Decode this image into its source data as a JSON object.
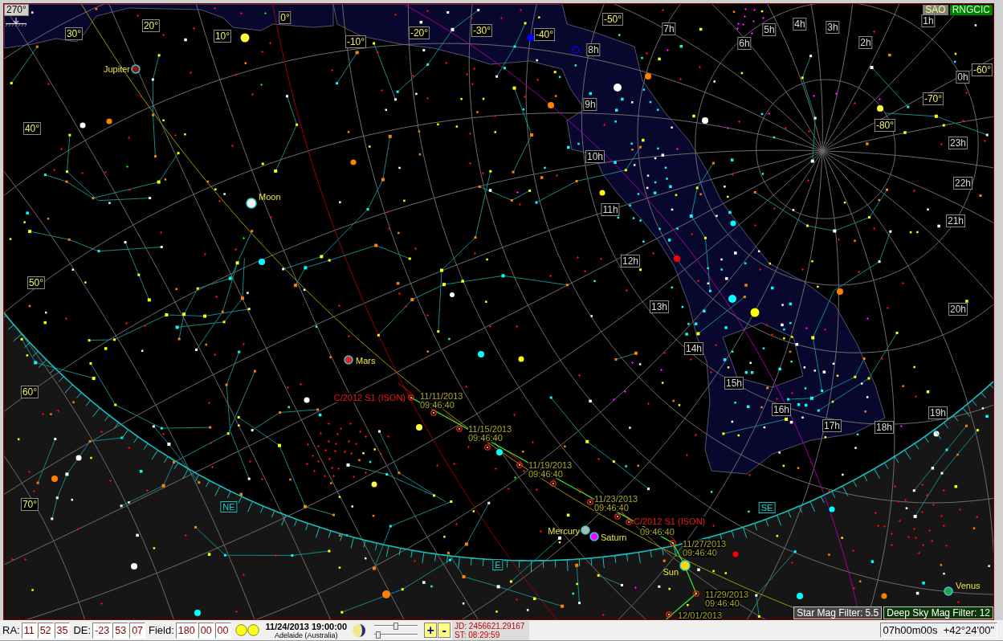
{
  "chart": {
    "corner_label": "270°",
    "catalogs": [
      {
        "label": "SAO",
        "on": false
      },
      {
        "label": "RNGCIC",
        "on": true
      }
    ],
    "grid_labels": [
      {
        "text": "30°",
        "kind": "declination"
      },
      {
        "text": "20°",
        "kind": "declination"
      },
      {
        "text": "10°",
        "kind": "declination"
      },
      {
        "text": "0°",
        "kind": "declination"
      },
      {
        "text": "-10°",
        "kind": "declination"
      },
      {
        "text": "-20°",
        "kind": "declination"
      },
      {
        "text": "-30°",
        "kind": "declination"
      },
      {
        "text": "-40°",
        "kind": "declination"
      },
      {
        "text": "-50°",
        "kind": "declination"
      },
      {
        "text": "7h",
        "kind": "hour"
      },
      {
        "text": "6h",
        "kind": "hour"
      },
      {
        "text": "5h",
        "kind": "hour"
      },
      {
        "text": "4h",
        "kind": "hour"
      },
      {
        "text": "3h",
        "kind": "hour"
      },
      {
        "text": "2h",
        "kind": "hour"
      },
      {
        "text": "1h",
        "kind": "hour"
      },
      {
        "text": "8h",
        "kind": "hour"
      },
      {
        "text": "0h",
        "kind": "hour"
      },
      {
        "text": "-60°",
        "kind": "declination"
      },
      {
        "text": "-70°",
        "kind": "declination"
      },
      {
        "text": "9h",
        "kind": "hour"
      },
      {
        "text": "-80°",
        "kind": "declination"
      },
      {
        "text": "40°",
        "kind": "declination"
      },
      {
        "text": "23h",
        "kind": "hour"
      },
      {
        "text": "10h",
        "kind": "hour"
      },
      {
        "text": "22h",
        "kind": "hour"
      },
      {
        "text": "11h",
        "kind": "hour"
      },
      {
        "text": "21h",
        "kind": "hour"
      },
      {
        "text": "12h",
        "kind": "hour"
      },
      {
        "text": "50°",
        "kind": "declination"
      },
      {
        "text": "13h",
        "kind": "hour"
      },
      {
        "text": "20h",
        "kind": "hour"
      },
      {
        "text": "14h",
        "kind": "hour"
      },
      {
        "text": "15h",
        "kind": "hour"
      },
      {
        "text": "60°",
        "kind": "declination"
      },
      {
        "text": "16h",
        "kind": "hour"
      },
      {
        "text": "19h",
        "kind": "hour"
      },
      {
        "text": "17h",
        "kind": "hour"
      },
      {
        "text": "18h",
        "kind": "hour"
      },
      {
        "text": "70°",
        "kind": "declination"
      }
    ],
    "horizon_labels": [
      "NE",
      "E",
      "SE"
    ],
    "bodies": [
      {
        "name": "Jupiter",
        "color": "#9a1010"
      },
      {
        "name": "Moon",
        "color": "#f0f0f0"
      },
      {
        "name": "Mars",
        "color": "#e82020"
      },
      {
        "name": "Mercury",
        "color": "#b4b4b4"
      },
      {
        "name": "Saturn",
        "color": "#ff00ff"
      },
      {
        "name": "Sun",
        "color": "#ffd800"
      },
      {
        "name": "Venus",
        "color": "#28a048"
      }
    ],
    "comet": {
      "name": "C/2012 S1 (ISON)",
      "current_label": "C/2012 S1 (ISON)",
      "path_labels": [
        {
          "date": "11/11/2013",
          "time": "09:46:40"
        },
        {
          "date": "11/15/2013",
          "time": "09:46:40"
        },
        {
          "date": "11/19/2013",
          "time": "09:46:40"
        },
        {
          "date": "11/23/2013",
          "time": "09:46:40"
        },
        {
          "time": "09:46:40"
        },
        {
          "date": "11/27/2013",
          "time": "09:46:40"
        },
        {
          "date": "11/29/2013",
          "time": "09:46:40"
        },
        {
          "date": "12/01/2013"
        }
      ]
    },
    "filters": [
      {
        "kind": "star",
        "text": "Star Mag Filter: 5.5"
      },
      {
        "kind": "deep_sky",
        "text": "Deep Sky Mag Filter: 12"
      }
    ]
  },
  "status_bar": {
    "ra": {
      "label": "RA:",
      "values": [
        "11",
        "52",
        "35"
      ]
    },
    "de": {
      "label": "DE:",
      "values": [
        "-23",
        "53",
        "07"
      ]
    },
    "field": {
      "label": "Field:",
      "values": [
        "180",
        "00",
        "00"
      ]
    },
    "datetime": "11/24/2013 19:00:00",
    "location": "Adelaide (Australia)",
    "sliders": [
      {
        "level": 0.5
      },
      {
        "level": 0.05
      }
    ],
    "zoom_buttons": [
      "+",
      "-"
    ],
    "julian_date": "JD: 2456621.29167",
    "sidereal_time": "ST: 08:29:59",
    "cursor_position": "07h00m00s  +42°24'00\""
  }
}
